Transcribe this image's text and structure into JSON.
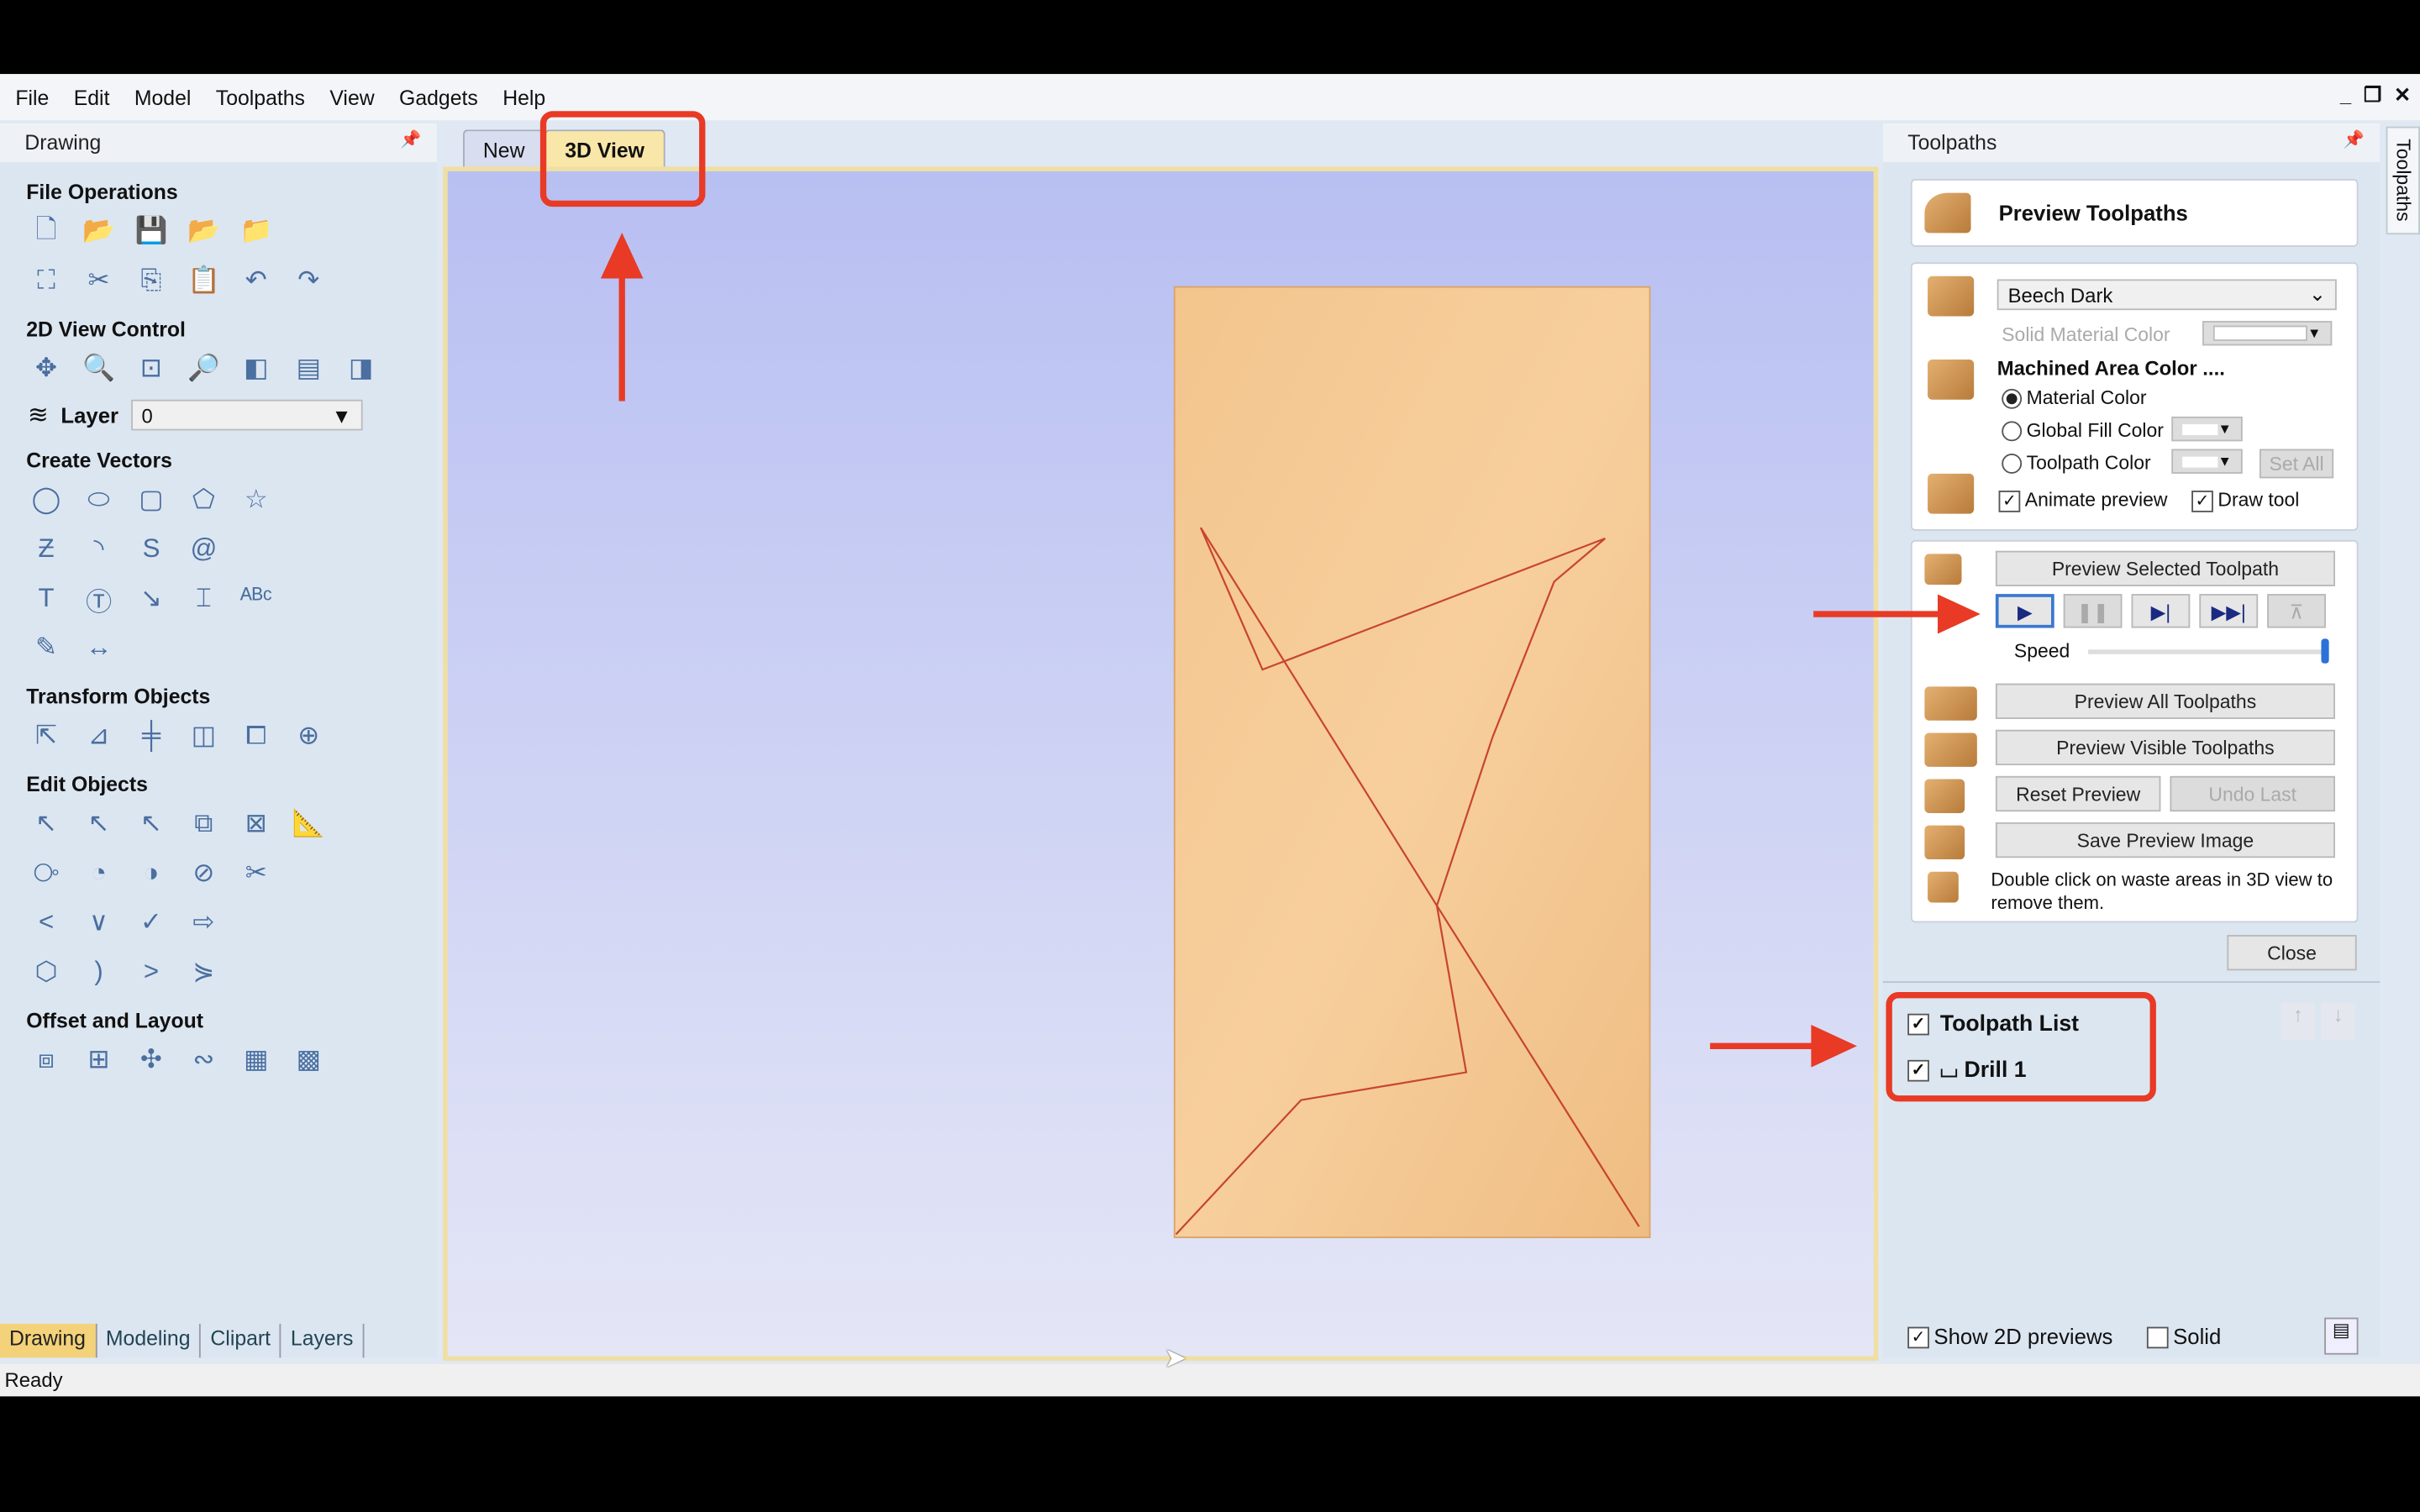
{
  "menu": [
    "File",
    "Edit",
    "Model",
    "Toolpaths",
    "View",
    "Gadgets",
    "Help"
  ],
  "window_controls": [
    "_",
    "❐",
    "✕"
  ],
  "left_panel": {
    "title": "Drawing",
    "sections": [
      {
        "title": "File Operations",
        "rows": [
          [
            "new-file",
            "open-folder",
            "save",
            "open-recent",
            "import"
          ],
          [
            "select-all",
            "cut",
            "copy",
            "paste",
            "undo",
            "redo"
          ]
        ]
      },
      {
        "title": "2D View Control",
        "rows": [
          [
            "pan",
            "zoom-box",
            "zoom-fit",
            "zoom-selection",
            "view-left",
            "view-split",
            "view-right"
          ]
        ]
      },
      {
        "title": "Create Vectors",
        "rows": [
          [
            "circle",
            "ellipse",
            "rectangle",
            "polygon",
            "star"
          ],
          [
            "polyline",
            "arc",
            "curve",
            "spiral"
          ],
          [
            "text",
            "text-frame",
            "text-on-curve",
            "auto-layout-text",
            "text-arc"
          ],
          [
            "draw-shape",
            "dimension"
          ]
        ]
      },
      {
        "title": "Transform Objects",
        "rows": [
          [
            "move",
            "scale",
            "align",
            "mirror",
            "distort",
            "center"
          ]
        ]
      },
      {
        "title": "Edit Objects",
        "rows": [
          [
            "select",
            "node-edit",
            "transform-select",
            "group",
            "ungroup",
            "measure"
          ],
          [
            "weld",
            "subtract",
            "intersect",
            "trim",
            "scissors"
          ],
          [
            "fillet",
            "corner",
            "smooth",
            "extend"
          ],
          [
            "close-vector",
            "join",
            "connect",
            "join-open"
          ]
        ]
      },
      {
        "title": "Offset and Layout",
        "rows": [
          [
            "offset",
            "array",
            "rotate-copy",
            "copy-along-curve",
            "nest",
            "tile"
          ]
        ]
      }
    ],
    "layer_label": "Layer",
    "layer_value": "0",
    "bottom_tabs": [
      "Drawing",
      "Modeling",
      "Clipart",
      "Layers"
    ],
    "active_bottom_tab": "Drawing"
  },
  "view_tabs": [
    {
      "label": "New"
    },
    {
      "label": "3D View",
      "active": true
    }
  ],
  "viewport": {
    "material_color": "#f3c58d",
    "toolpath_color": "#c8452e"
  },
  "right_panel": {
    "title": "Toolpaths",
    "side_tab": "Toolpaths",
    "header": "Preview Toolpaths",
    "material": "Beech Dark",
    "solid_material_color": "Solid Material Color",
    "machined_area_title": "Machined Area Color ....",
    "radio": [
      {
        "label": "Material Color",
        "checked": true
      },
      {
        "label": "Global Fill Color",
        "checked": false
      },
      {
        "label": "Toolpath Color",
        "checked": false
      }
    ],
    "set_all": "Set All",
    "animate_preview": "Animate preview",
    "draw_tool": "Draw tool",
    "preview_selected": "Preview Selected Toolpath",
    "speed_label": "Speed",
    "speed_value": 100,
    "preview_all": "Preview All Toolpaths",
    "preview_visible": "Preview Visible Toolpaths",
    "reset_preview": "Reset Preview",
    "undo_last": "Undo Last",
    "save_image": "Save Preview Image",
    "hint": "Double click on waste areas in 3D view to remove them.",
    "close": "Close",
    "toolpath_list_title": "Toolpath List",
    "toolpaths": [
      {
        "name": "Drill 1",
        "checked": true
      }
    ],
    "show_2d": "Show 2D previews",
    "solid": "Solid"
  },
  "status": "Ready",
  "annotation_color": "#e83a25"
}
